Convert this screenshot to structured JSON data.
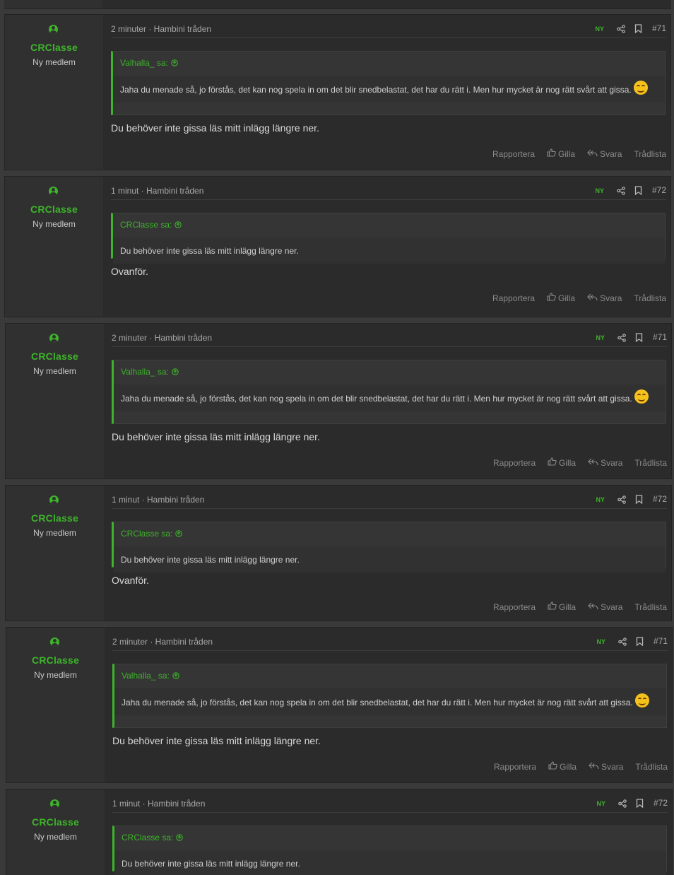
{
  "posts": [
    {
      "user": "CRClasse",
      "title": "Ny medlem",
      "meta": "2 minuter · Hambini tråden",
      "badge": "NY",
      "number": "#71",
      "quote_author": "Valhalla_ sa:",
      "quote_text": "Jaha du menade så, jo förstås, det kan nog spela in om det blir snedbelastat, det har du rätt i. Men hur mycket är nog rätt svårt att gissa.",
      "quote_emoji": "smiling-face-icon",
      "text": "Du behöver inte gissa läs mitt inlägg längre ner."
    },
    {
      "user": "CRClasse",
      "title": "Ny medlem",
      "meta": "1 minut · Hambini tråden",
      "badge": "NY",
      "number": "#72",
      "quote_author": "CRClasse sa:",
      "quote_text": "Du behöver inte gissa läs mitt inlägg längre ner.",
      "quote_emoji": "",
      "text": "Ovanför."
    },
    {
      "user": "CRClasse",
      "title": "Ny medlem",
      "meta": "2 minuter · Hambini tråden",
      "badge": "NY",
      "number": "#71",
      "quote_author": "Valhalla_ sa:",
      "quote_text": "Jaha du menade så, jo förstås, det kan nog spela in om det blir snedbelastat, det har du rätt i. Men hur mycket är nog rätt svårt att gissa.",
      "quote_emoji": "smiling-face-icon",
      "text": "Du behöver inte gissa läs mitt inlägg längre ner."
    },
    {
      "user": "CRClasse",
      "title": "Ny medlem",
      "meta": "1 minut · Hambini tråden",
      "badge": "NY",
      "number": "#72",
      "quote_author": "CRClasse sa:",
      "quote_text": "Du behöver inte gissa läs mitt inlägg längre ner.",
      "quote_emoji": "",
      "text": "Ovanför."
    },
    {
      "user": "CRClasse",
      "title": "Ny medlem",
      "meta": "2 minuter · Hambini tråden",
      "badge": "NY",
      "number": "#71",
      "quote_author": "Valhalla_ sa:",
      "quote_text": "Jaha du menade så, jo förstås, det kan nog spela in om det blir snedbelastat, det har du rätt i. Men hur mycket är nog rätt svårt att gissa.",
      "quote_emoji": "smiling-face-icon",
      "text": "Du behöver inte gissa läs mitt inlägg längre ner."
    },
    {
      "user": "CRClasse",
      "title": "Ny medlem",
      "meta": "1 minut · Hambini tråden",
      "badge": "NY",
      "number": "#72",
      "quote_author": "CRClasse sa:",
      "quote_text": "Du behöver inte gissa läs mitt inlägg längre ner.",
      "quote_emoji": "",
      "text": ""
    }
  ],
  "actions": {
    "report": "Rapportera",
    "like": "Gilla",
    "reply": "Svara",
    "threadlist": "Trådlista"
  },
  "colors": {
    "accent": "#3db42a",
    "post_bg": "#2b2b2b",
    "user_bg": "#303030",
    "page_bg": "#3a3a3a"
  }
}
